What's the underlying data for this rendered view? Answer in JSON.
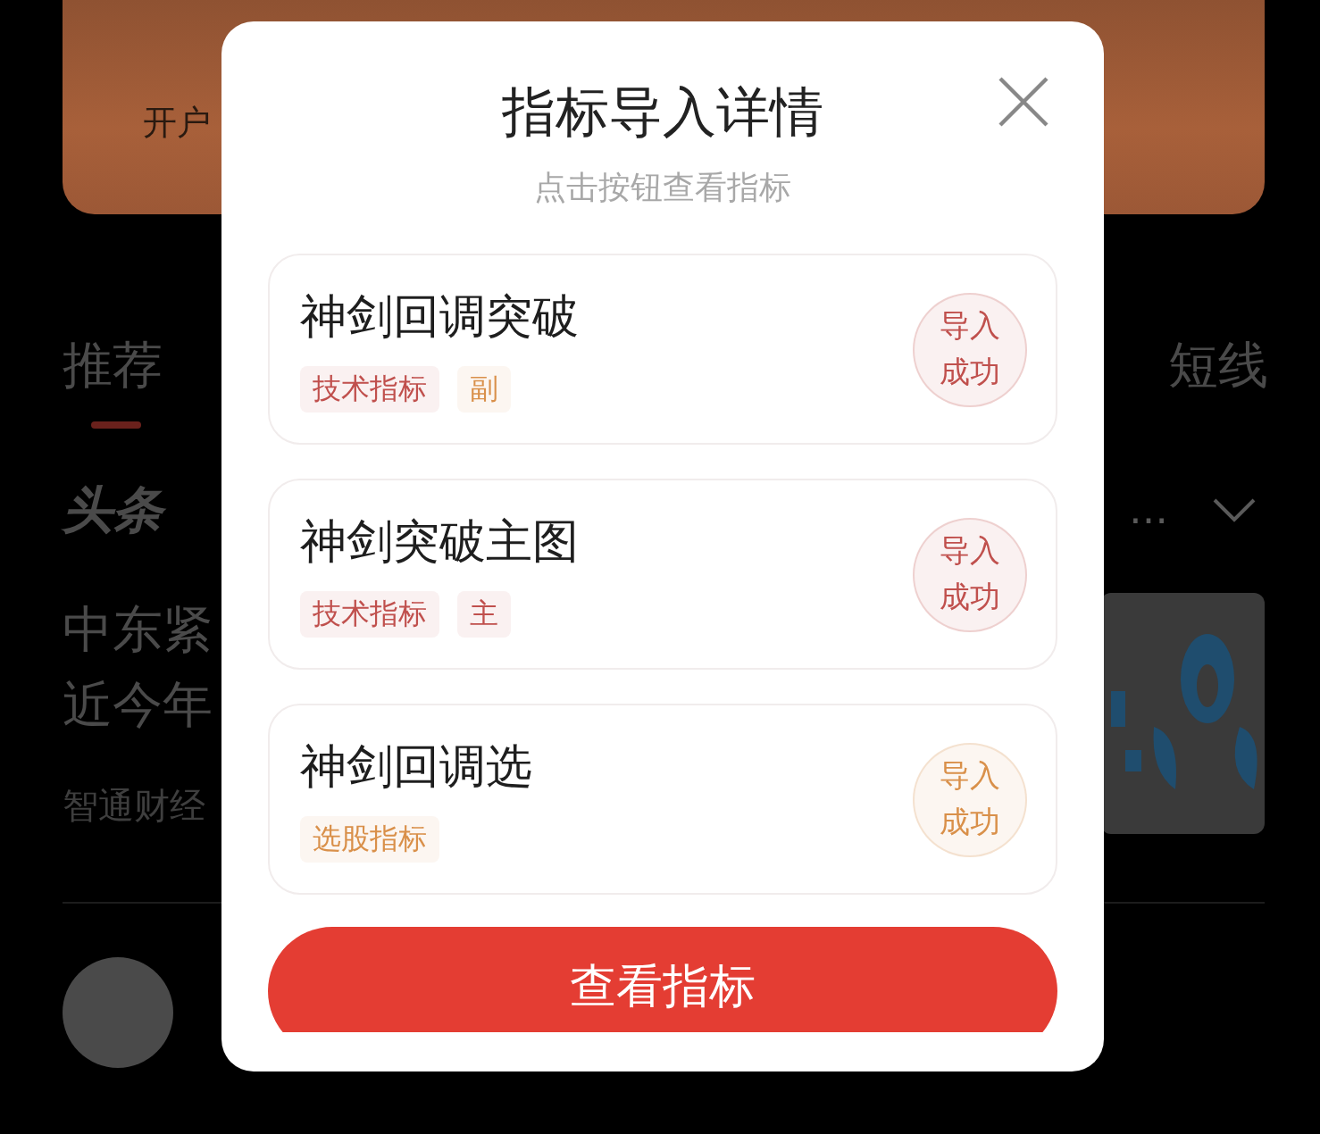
{
  "background": {
    "banner": {
      "text": "开户"
    },
    "tabs": [
      {
        "label": "推荐",
        "selected": true
      },
      {
        "label": "短线",
        "selected": false
      }
    ],
    "section": {
      "title": "头条",
      "more": "…"
    },
    "article": {
      "title_lines": [
        "中东紧",
        "近今年"
      ],
      "source": "智通财经",
      "thumbnail": {
        "kind": "picture"
      }
    }
  },
  "dialog": {
    "title": "指标导入详情",
    "subtitle": "点击按钮查看指标",
    "items": [
      {
        "name": "神剑回调突破",
        "tags": [
          {
            "label": "技术指标",
            "color": "#c0504d"
          },
          {
            "label": "副",
            "color": "#d9904a"
          }
        ],
        "status": "导入成功",
        "color": "#c0504d"
      },
      {
        "name": "神剑突破主图",
        "tags": [
          {
            "label": "技术指标",
            "color": "#c0504d"
          },
          {
            "label": "主",
            "color": "#c0504d"
          }
        ],
        "status": "导入成功",
        "color": "#c0504d"
      },
      {
        "name": "神剑回调选",
        "tags": [
          {
            "label": "选股指标",
            "color": "#d9904a"
          }
        ],
        "status": "导入成功",
        "color": "#d9904a"
      }
    ],
    "button": "查看指标"
  }
}
